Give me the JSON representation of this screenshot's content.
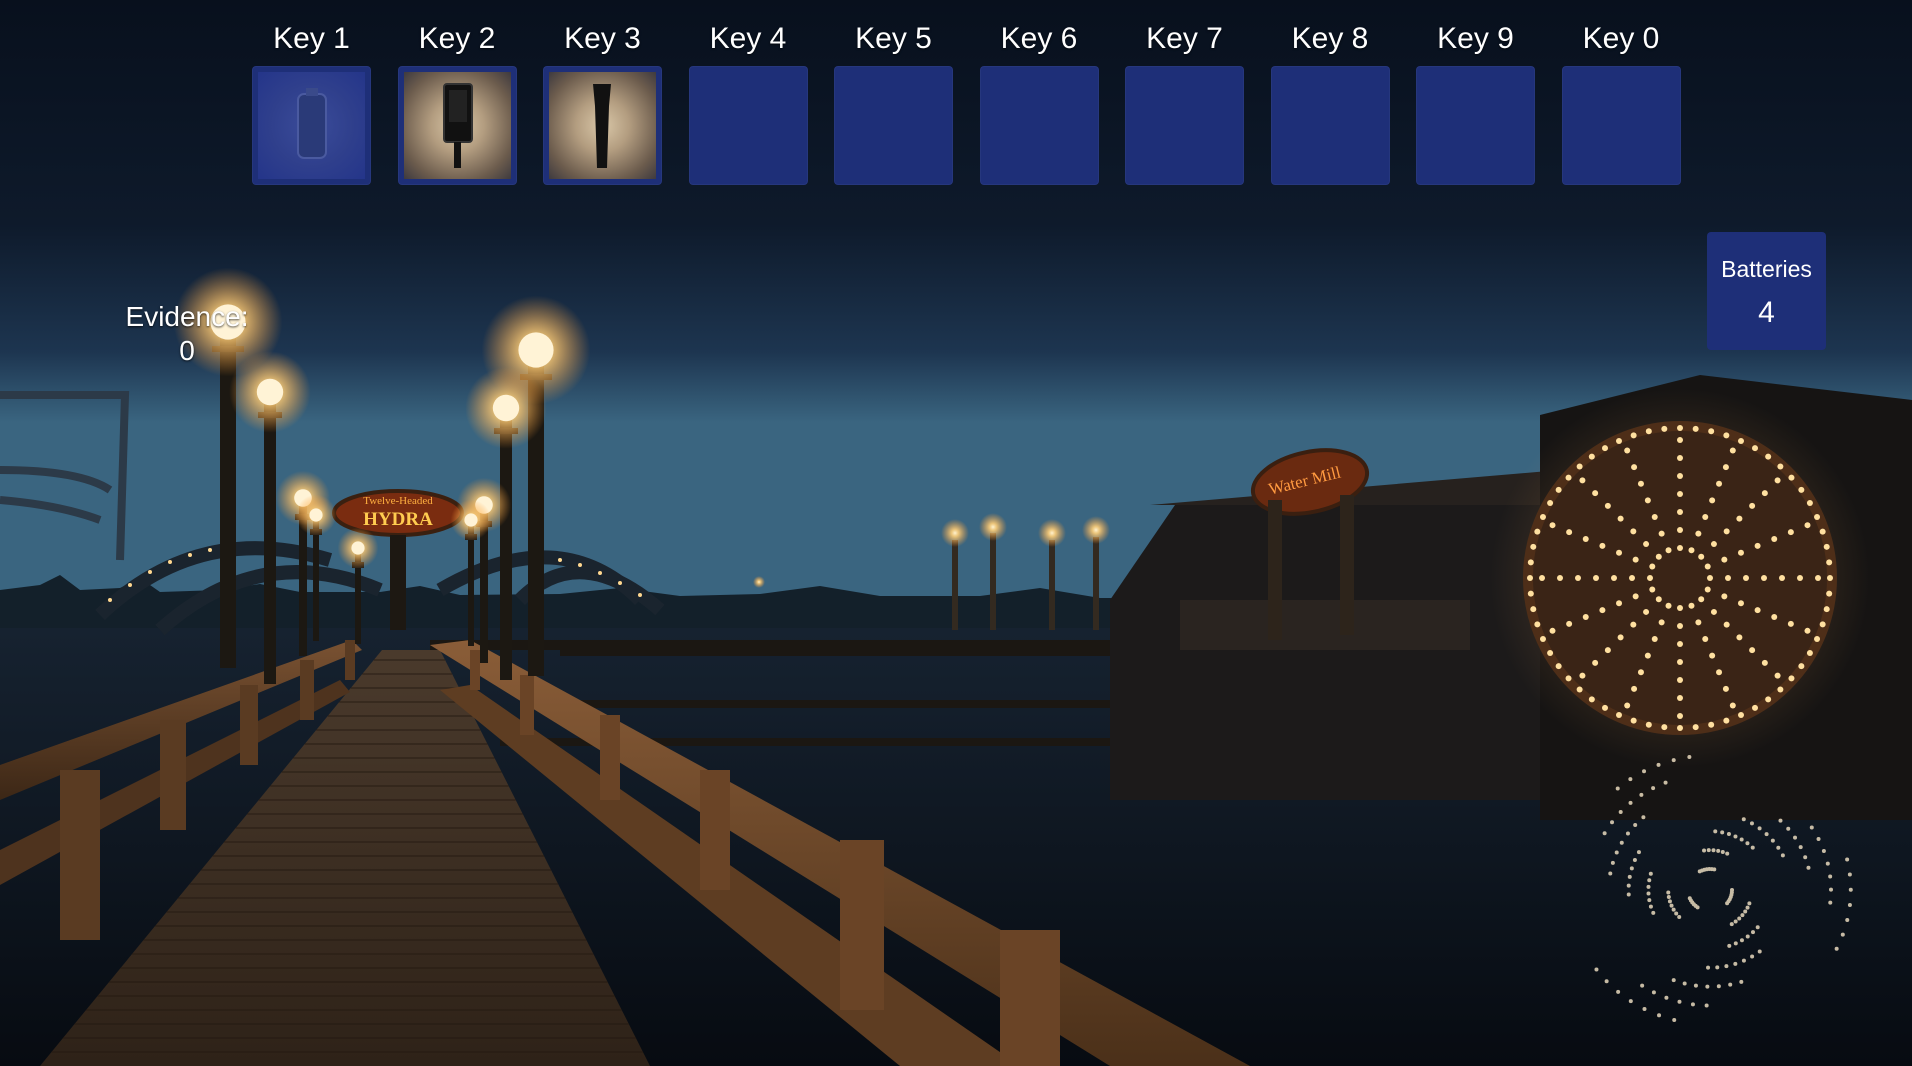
{
  "hud": {
    "hotbar": [
      {
        "label": "Key 1",
        "item": "battery-icon",
        "faded": true
      },
      {
        "label": "Key 2",
        "item": "emf-reader-icon",
        "faded": false
      },
      {
        "label": "Key 3",
        "item": "flashlight-icon",
        "faded": false
      },
      {
        "label": "Key 4",
        "item": null
      },
      {
        "label": "Key 5",
        "item": null
      },
      {
        "label": "Key 6",
        "item": null
      },
      {
        "label": "Key 7",
        "item": null
      },
      {
        "label": "Key 8",
        "item": null
      },
      {
        "label": "Key 9",
        "item": null
      },
      {
        "label": "Key 0",
        "item": null
      }
    ],
    "evidence": {
      "label": "Evidence:",
      "value": "0"
    },
    "batteries": {
      "label": "Batteries",
      "value": "4"
    }
  },
  "scene": {
    "signs": {
      "hydra_top": "Twelve-Headed",
      "hydra": "HYDRA",
      "water_mill": "Water Mill"
    },
    "colors": {
      "hud_slot": "#1e2f78",
      "sky_top": "#0a1220",
      "sky_horizon": "#2f5470",
      "lamp_glow": "#ffcf7a",
      "wood": "#6b4a2e"
    }
  }
}
